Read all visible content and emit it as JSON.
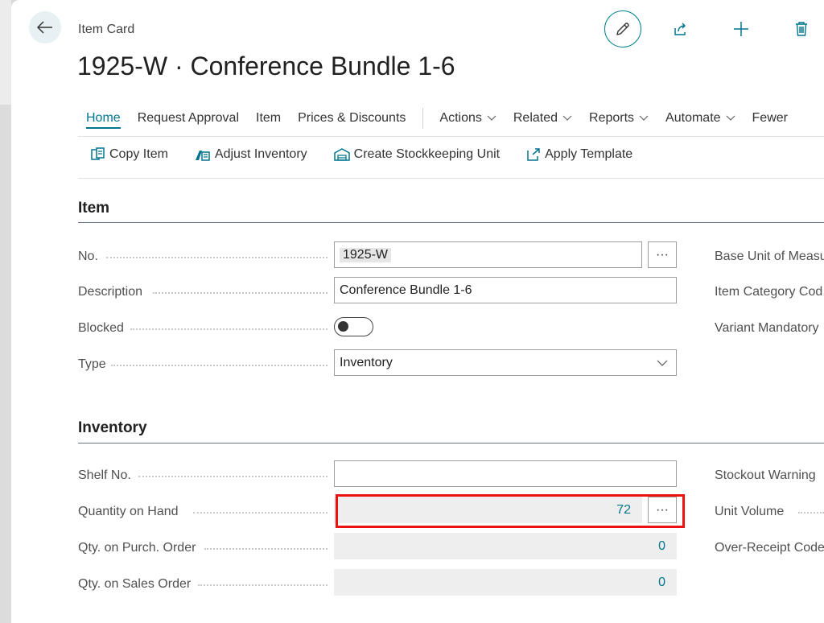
{
  "header": {
    "caption": "Item Card",
    "title": "1925-W · Conference Bundle 1-6"
  },
  "nav": {
    "home": "Home",
    "request_approval": "Request Approval",
    "item": "Item",
    "prices_discounts": "Prices & Discounts",
    "actions": "Actions",
    "related": "Related",
    "reports": "Reports",
    "automate": "Automate",
    "fewer": "Fewer"
  },
  "actions": {
    "copy_item": "Copy Item",
    "adjust_inventory": "Adjust Inventory",
    "create_sku": "Create Stockkeeping Unit",
    "apply_template": "Apply Template"
  },
  "item_section": {
    "title": "Item",
    "no_label": "No.",
    "no_value": "1925-W",
    "description_label": "Description",
    "description_value": "Conference Bundle 1-6",
    "blocked_label": "Blocked",
    "type_label": "Type",
    "type_value": "Inventory",
    "base_unit_label": "Base Unit of Measu",
    "item_category_label": "Item Category Cod",
    "variant_mandatory_label": "Variant Mandatory"
  },
  "inventory_section": {
    "title": "Inventory",
    "shelf_label": "Shelf No.",
    "shelf_value": "",
    "qoh_label": "Quantity on Hand",
    "qoh_value": "72",
    "purch_label": "Qty. on Purch. Order",
    "purch_value": "0",
    "sales_label": "Qty. on Sales Order",
    "sales_value": "0",
    "stockout_label": "Stockout Warning",
    "unit_volume_label": "Unit Volume",
    "over_receipt_label": "Over-Receipt Code"
  },
  "ellipsis": "···",
  "colors": {
    "accent": "#00758f",
    "highlight": "#ee1111"
  }
}
